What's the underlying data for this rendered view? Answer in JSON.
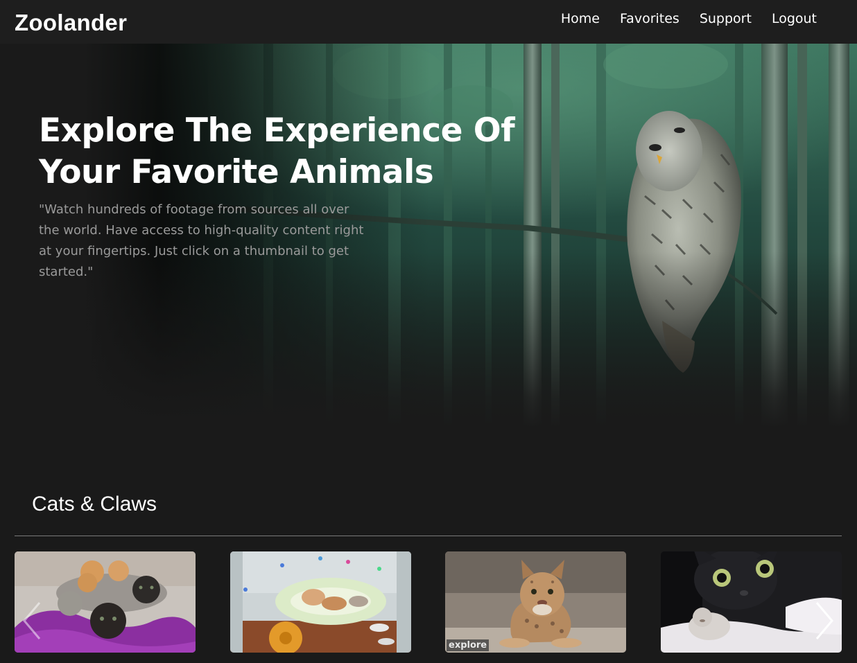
{
  "navbar": {
    "brand": "Zoolander",
    "links": [
      {
        "label": "Home"
      },
      {
        "label": "Favorites"
      },
      {
        "label": "Support"
      },
      {
        "label": "Logout"
      }
    ]
  },
  "hero": {
    "title_line1": "Explore The Experience Of",
    "title_line2": "Your Favorite Animals",
    "description": "\"Watch hundreds of footage from sources all over the world. Have access to high-quality content right at your fingertips. Just click on a thumbnail to get started.\""
  },
  "section": {
    "title": "Cats & Claws"
  },
  "carousel": {
    "prev_icon": "chevron-left-icon",
    "next_icon": "chevron-right-icon",
    "thumbnails": [
      {
        "subject": "kittens on purple blanket"
      },
      {
        "subject": "kittens in pen with toy"
      },
      {
        "subject": "bobcat kitten",
        "badge": "explore"
      },
      {
        "subject": "black cat with kitten"
      }
    ]
  },
  "colors": {
    "background": "#1a1a1a",
    "navbar": "#1e1e1e",
    "text": "#ffffff",
    "muted_text": "#9a9a9a",
    "divider": "#7a7a7a"
  }
}
